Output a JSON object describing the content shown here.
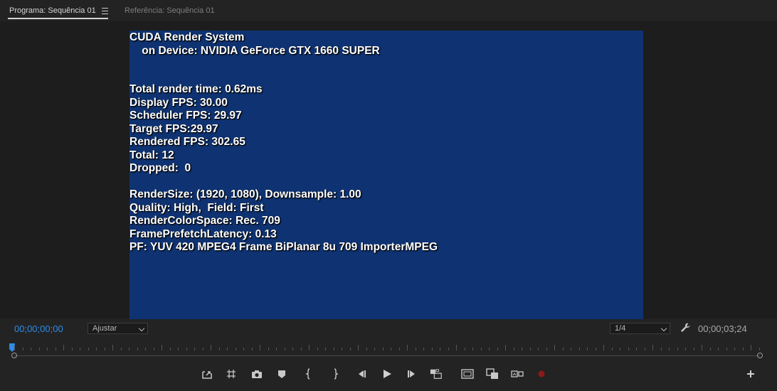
{
  "tabs": [
    {
      "label": "Programa: Sequência 01",
      "active": true
    },
    {
      "label": "Referência: Sequência 01",
      "active": false
    }
  ],
  "overlay": {
    "lines": [
      "CUDA Render System",
      "    on Device: NVIDIA GeForce GTX 1660 SUPER",
      "",
      "",
      "Total render time: 0.62ms",
      "Display FPS: 30.00",
      "Scheduler FPS: 29.97",
      "Target FPS:29.97",
      "Rendered FPS: 302.65",
      "Total: 12",
      "Dropped:  0",
      "",
      "RenderSize: (1920, 1080), Downsample: 1.00",
      "Quality: High,  Field: First",
      "RenderColorSpace: Rec. 709",
      "FramePrefetchLatency: 0.13",
      "PF: YUV 420 MPEG4 Frame BiPlanar 8u 709 ImporterMPEG"
    ]
  },
  "controls": {
    "current_timecode": "00;00;00;00",
    "zoom_select": "Ajustar",
    "resolution_select": "1/4",
    "duration_timecode": "00;00;03;24"
  },
  "colors": {
    "video_background": "#0f3372",
    "timecode_accent": "#2d8ceb",
    "record_button": "#8b1a1a"
  },
  "transport_buttons": [
    "insert-marker-icon",
    "add-edit-icon",
    "export-frame-icon",
    "mark-icon",
    "mark-in-icon",
    "mark-out-icon",
    "step-back-icon",
    "play-icon",
    "step-forward-icon",
    "multicam-icon",
    "safe-margins-icon",
    "compare-view-icon",
    "vr-video-icon",
    "record-icon",
    "add-button-icon"
  ]
}
